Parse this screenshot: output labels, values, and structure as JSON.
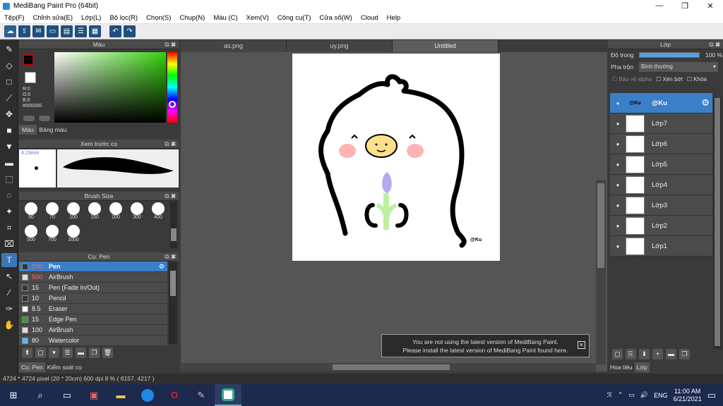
{
  "window": {
    "title": "MediBang Paint Pro (64bit)",
    "min": "—",
    "max": "❐",
    "close": "✕"
  },
  "menu": [
    "Tệp(F)",
    "Chỉnh sửa(E)",
    "Lớp(L)",
    "Bộ lọc(R)",
    "Chọn(S)",
    "Chụp(N)",
    "Màu (C)",
    "Xem(V)",
    "Công cụ(T)",
    "Cửa sổ(W)",
    "Cloud",
    "Help"
  ],
  "color_panel": {
    "title": "Màu",
    "rgb": {
      "r": "R:0",
      "g": "G:0",
      "b": "B:0",
      "hex": "#000000"
    },
    "tabs": [
      "Màu",
      "Bảng màu"
    ],
    "hue_colors": [
      "#ff0000",
      "#ffff00",
      "#00ff00",
      "#00ffff",
      "#0000ff",
      "#ff00ff",
      "#ff0000"
    ],
    "picker_color": "#35d10a"
  },
  "preview_panel": {
    "title": "Xem trước cọ",
    "size": "4.23mm"
  },
  "brush_size_panel": {
    "title": "Brush Size",
    "sizes": [
      "50",
      "70",
      "100",
      "150",
      "200",
      "300",
      "400",
      "500",
      "700",
      "1000"
    ]
  },
  "brush_panel": {
    "title": "Cọ: Pen",
    "items": [
      {
        "size": "100",
        "name": "Pen",
        "color": "#333333"
      },
      {
        "size": "500",
        "name": "AirBrush",
        "color": "#dddddd"
      },
      {
        "size": "15",
        "name": "Pen (Fade In/Out)",
        "color": "#333333"
      },
      {
        "size": "10",
        "name": "Pencil",
        "color": "#333333"
      },
      {
        "size": "8.5",
        "name": "Eraser",
        "color": "#ffffff"
      },
      {
        "size": "15",
        "name": "Edge Pen",
        "color": "#22aa22"
      },
      {
        "size": "100",
        "name": "AirBrush",
        "color": "#dddddd"
      },
      {
        "size": "80",
        "name": "Watercolor",
        "color": "#55bbff"
      }
    ],
    "bottom_tabs": [
      "Cọ: Pen",
      "Kiểm soát cọ"
    ]
  },
  "tabs": [
    "as.png",
    "uy.png",
    "Untitled"
  ],
  "canvas": {
    "signature": "@Ku"
  },
  "notice": {
    "line1": "You are not using the latest version of MediBang Paint.",
    "line2": "Please install the latest version of MediBang Paint found here."
  },
  "layer_panel": {
    "title": "Lớp",
    "opacity_label": "Độ trong",
    "opacity_value": "100 %",
    "opacity_fraction": 1.0,
    "blend_label": "Pha trộn",
    "blend_value": "Bình thường",
    "checkboxes": [
      "Bảo vệ alpha",
      "Xén bớt",
      "Khóa"
    ],
    "layers": [
      {
        "name": "@Ku",
        "thumb": "@Ku"
      },
      {
        "name": "Lớp7",
        "thumb": ""
      },
      {
        "name": "Lớp6",
        "thumb": ""
      },
      {
        "name": "Lớp5",
        "thumb": ""
      },
      {
        "name": "Lớp4",
        "thumb": ""
      },
      {
        "name": "Lớp3",
        "thumb": ""
      },
      {
        "name": "Lớp2",
        "thumb": ""
      },
      {
        "name": "Lớp1",
        "thumb": ""
      }
    ],
    "bottom_tabs": [
      "Hoa tiêu",
      "Lớp"
    ]
  },
  "status": "4724 * 4724 pixel   (20 * 20cm)   600 dpi   8 %   ( 6157, 4217 )",
  "taskbar": {
    "lang": "ENG",
    "time": "11:00 AM",
    "date": "6/21/2021"
  }
}
